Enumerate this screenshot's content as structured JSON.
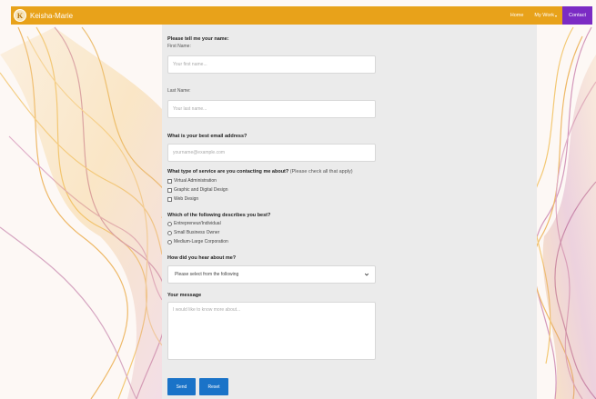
{
  "navbar": {
    "brand_initial": "K",
    "brand_name": "Keisha-Marie",
    "links": [
      "Home",
      "My Work",
      "Contact"
    ],
    "caret": "▾",
    "color": "#e8a21a",
    "active_color": "#7b2bc4"
  },
  "form": {
    "name_heading": "Please tell me your name:",
    "first_name_label": "First Name:",
    "first_name_placeholder": "Your first name...",
    "last_name_label": "Last Name:",
    "last_name_placeholder": "Your last name...",
    "email_heading": "What is your best email address?",
    "email_placeholder": "yourname@example.com",
    "service_heading": "What type of service are you contacting me about?",
    "service_note": "(Please check all that apply)",
    "service_options": [
      "Virtual Administration",
      "Graphic and Digital Design",
      "Web Design"
    ],
    "describe_heading": "Which of the following describes you best?",
    "describe_options": [
      "Entrepreneur/Individual",
      "Small Business Owner",
      "Medium-Large Corporation"
    ],
    "hear_heading": "How did you hear about me?",
    "hear_selected": "Please select from the following",
    "message_heading": "Your message",
    "message_placeholder": "I would like to know more about...",
    "send_label": "Send",
    "reset_label": "Reset"
  }
}
